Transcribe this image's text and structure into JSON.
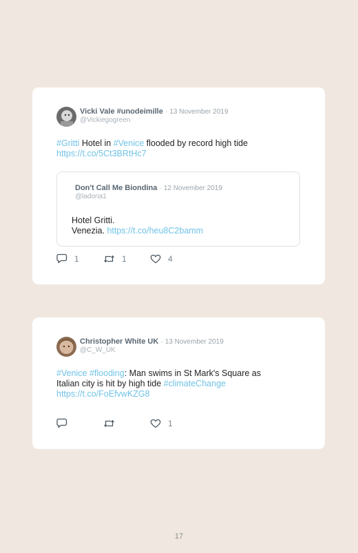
{
  "tweets": [
    {
      "author_name": "Vicki Vale #unodeimille",
      "date": "13 November 2019",
      "handle": "@Vickiegogreen",
      "text_tag1": "#Gritti",
      "text_mid1": " Hotel in ",
      "text_tag2": "#Venice",
      "text_mid2": " flooded by record high tide",
      "link": "https://t.co/5Ct3BRtHc7",
      "quoted": {
        "author_name": "Don't Call Me Biondina",
        "date": "12 November 2019",
        "handle": "@ladoria1",
        "line1": "Hotel Gritti.",
        "line2_prefix": "Venezia. ",
        "link": "https://t.co/heu8C2bamm"
      },
      "replies": "1",
      "retweets": "1",
      "likes": "4"
    },
    {
      "author_name": "Christopher White UK",
      "date": "13 November 2019",
      "handle": "@C_W_UK",
      "text_tag1": "#Venice",
      "text_tag2": "#flooding",
      "text_mid1": ": Man swims in St Mark's Square as",
      "text_line2": "Italian city is hit by high tide ",
      "text_tag3": "#climateChange",
      "link": "https://t.co/FoEfvwKZG8",
      "replies": "",
      "retweets": "",
      "likes": "1"
    }
  ],
  "separator": "·",
  "icons": [
    "reply-icon",
    "retweet-icon",
    "like-icon"
  ],
  "colors": {
    "background": "#f0e8e0",
    "card": "#ffffff",
    "hashtag": "#6fc3e6",
    "name": "#5a6772"
  },
  "page_number": "17"
}
